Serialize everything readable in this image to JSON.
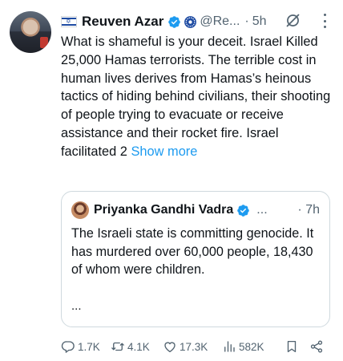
{
  "tweet": {
    "author": {
      "name": "Reuven Azar",
      "handle": "@Re...",
      "flag_icon": "israel-flag-icon",
      "verified_icon": "verified-badge-icon",
      "affiliate_icon": "government-affiliate-icon"
    },
    "separator": "·",
    "time": "5h",
    "grok_icon": "grok-icon",
    "more_icon": "more-options-icon",
    "body": "What is shameful is your deceit. Israel Killed 25,000 Hamas terrorists. The terrible cost in human lives derives from Hamas’s heinous tactics of hiding behind civilians, their shooting of people trying to evacuate or receive assistance and their rocket fire. Israel facilitated 2",
    "show_more": "Show more"
  },
  "quoted": {
    "author": {
      "name": "Priyanka Gandhi Vadra",
      "verified_icon": "verified-badge-icon"
    },
    "ellipsis": "...",
    "time": "· 7h",
    "body": "The Israeli state is committing genocide. It has murdered over 60,000 people, 18,430 of whom were children.",
    "truncation": "..."
  },
  "actions": {
    "reply_count": "1.7K",
    "repost_count": "4.1K",
    "like_count": "17.3K",
    "views_count": "582K"
  },
  "colors": {
    "text": "#0f1419",
    "muted": "#536471",
    "link": "#1d9bf0",
    "verified": "#1d9bf0",
    "border": "#cfd9de"
  }
}
